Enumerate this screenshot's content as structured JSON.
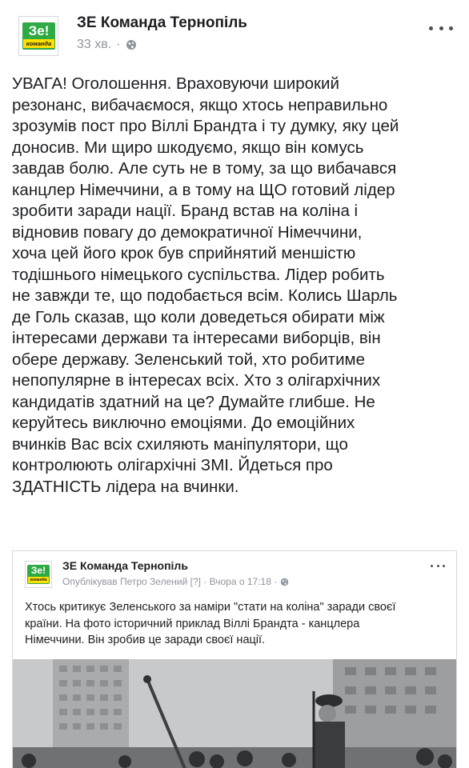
{
  "post": {
    "page_name": "ЗЕ Команда Тернопіль",
    "time": "33 хв.",
    "separator": "·",
    "avatar": {
      "logo_main": "Зе!",
      "logo_sub": "команда"
    },
    "text_lines": [
      "УВАГА! Оголошення. Враховуючи широкий",
      "резонанс, вибачаємося, якщо хтось неправильно",
      "зрозумів пост про Віллі Брандта і ту думку, яку цей",
      "доносив. Ми щиро шкодуємо, якщо він комусь",
      "завдав болю. Але суть не в тому, за що вибачався",
      "канцлер Німеччини, а в тому на ЩО готовий лідер",
      "зробити заради нації. Бранд встав на коліна і",
      "відновив повагу до демократичної Німеччини,",
      "хоча цей його крок був сприйнятий меншістю",
      "тодішнього німецького суспільства. Лідер робить",
      "не завжди те, що подобається всім. Колись Шарль",
      "де Голь сказав, що коли доведеться обирати між",
      "інтересами держави та інтересами виборців, він",
      "обере державу. Зеленський той, хто робитиме",
      "непопулярне в інтересах всіх. Хто з олігархічних",
      "кандидатів здатний на це? Думайте глибше. Не",
      "керуйтесь виключно емоціями. До емоційних",
      "вчинків Вас всіх схиляють маніпулятори, що",
      "контролюють олігархічні ЗМІ. Йдеться про",
      "ЗДАТНІСТЬ лідера на вчинки."
    ]
  },
  "shared": {
    "page_name": "ЗЕ Команда Тернопіль",
    "meta": "Опублікував Петро Зелений [?] · Вчора о 17:18 ·",
    "avatar": {
      "logo_main": "Зе!",
      "logo_sub": "команда"
    },
    "text_lines": [
      "Хтось критикує Зеленського за наміри \"стати на коліна\" заради своєї",
      "країни. На фото історичний приклад Віллі Брандта - канцлера",
      "Німеччини. Він зробив це заради своєї нації."
    ]
  },
  "icons": {
    "globe": "globe-icon",
    "more": "more-options-icon"
  },
  "colors": {
    "brand_green": "#2faa45",
    "brand_yellow": "#ffe000",
    "meta_gray": "#90949c"
  }
}
